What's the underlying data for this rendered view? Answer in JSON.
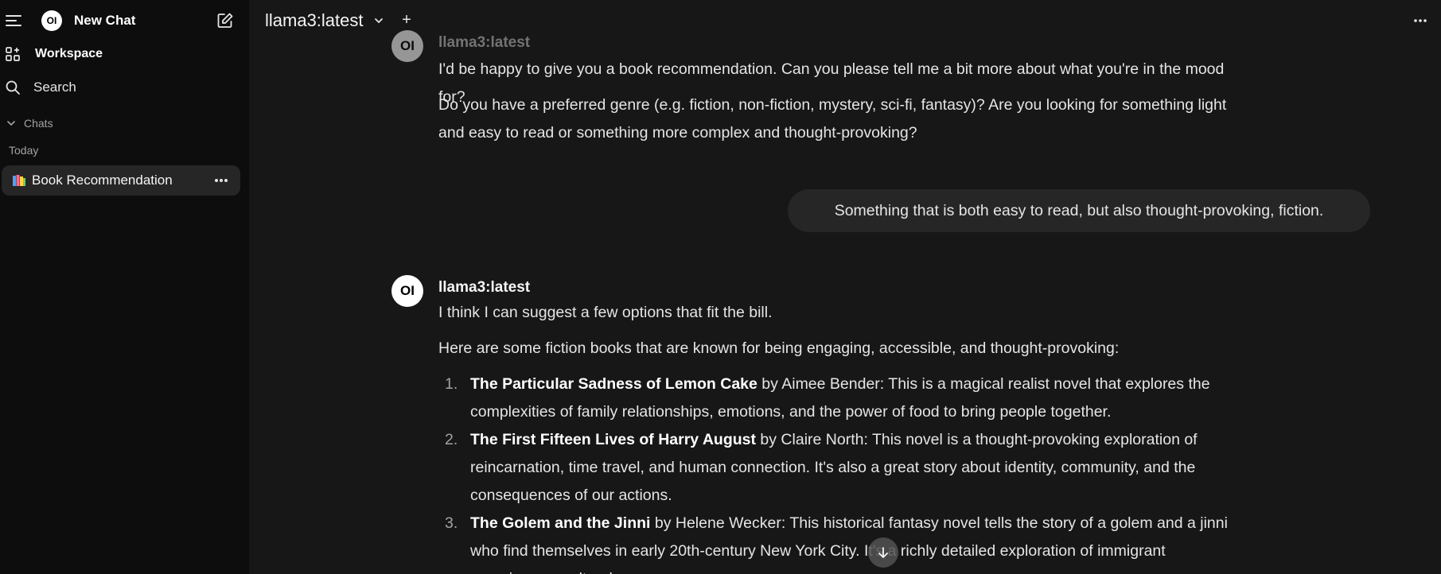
{
  "sidebar": {
    "logo_text": "OI",
    "new_chat_label": "New Chat",
    "workspace_label": "Workspace",
    "search_label": "Search",
    "chats_group_label": "Chats",
    "today_label": "Today",
    "chat_items": [
      {
        "label": "Book Recommendation",
        "icon": "books-emoji"
      }
    ]
  },
  "header": {
    "model_name": "llama3:latest",
    "add_model_symbol": "+"
  },
  "messages": {
    "assistant_1": {
      "avatar_text": "OI",
      "name": "llama3:latest",
      "paragraphs": [
        "I'd be happy to give you a book recommendation. Can you please tell me a bit more about what you're in the mood for?",
        "Do you have a preferred genre (e.g. fiction, non-fiction, mystery, sci-fi, fantasy)? Are you looking for something light and easy to read or something more complex and thought-provoking?"
      ]
    },
    "user_1": {
      "text": "Something that is both easy to read, but also thought-provoking, fiction."
    },
    "assistant_2": {
      "avatar_text": "OI",
      "name": "llama3:latest",
      "paragraphs": [
        "I think I can suggest a few options that fit the bill.",
        "Here are some fiction books that are known for being engaging, accessible, and thought-provoking:"
      ],
      "books": [
        {
          "num": "1.",
          "title": "The Particular Sadness of Lemon Cake",
          "rest": " by Aimee Bender: This is a magical realist novel that explores the complexities of family relationships, emotions, and the power of food to bring people together."
        },
        {
          "num": "2.",
          "title": "The First Fifteen Lives of Harry August",
          "rest": " by Claire North: This novel is a thought-provoking exploration of reincarnation, time travel, and human connection. It's also a great story about identity, community, and the consequences of our actions."
        },
        {
          "num": "3.",
          "title": "The Golem and the Jinni",
          "rest": " by Helene Wecker: This historical fantasy novel tells the story of a golem and a jinni who find themselves in early 20th-century New York City. It's a richly detailed exploration of immigrant experiences, cultural"
        }
      ]
    }
  },
  "colors": {
    "sidebar_bg": "#0d0d0d",
    "main_bg": "#171717",
    "bubble_bg": "#262626",
    "text": "#e5e5e5"
  }
}
